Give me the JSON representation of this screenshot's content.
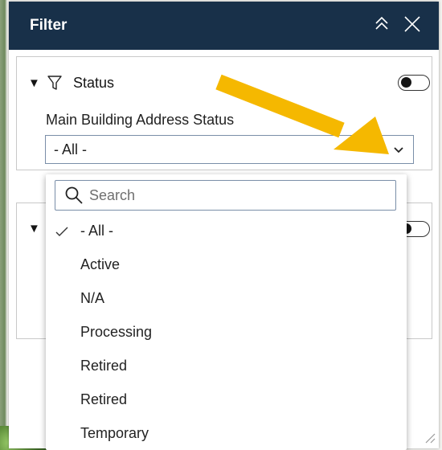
{
  "header": {
    "title": "Filter"
  },
  "filters": [
    {
      "name": "Status",
      "toggle_on": false,
      "field_label": "Main Building Address Status",
      "selected_value": "- All -"
    },
    {
      "toggle_on": false
    }
  ],
  "dropdown": {
    "search_placeholder": "Search",
    "selected_index": 0,
    "options": [
      "- All -",
      "Active",
      "N/A",
      "Processing",
      "Retired",
      "Retired",
      "Temporary"
    ]
  },
  "colors": {
    "header_bg": "#183049",
    "arrow": "#F5B800",
    "select_border": "#7a8ea8"
  },
  "icons": [
    "filter-icon",
    "collapse-icon",
    "close-icon",
    "chevron-down-icon",
    "search-icon",
    "check-icon",
    "annotation-arrow"
  ]
}
